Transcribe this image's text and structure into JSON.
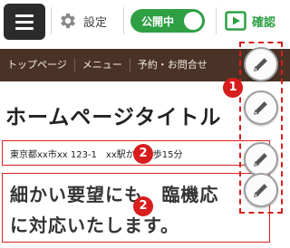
{
  "toolbar": {
    "settings_label": "設定",
    "publish_label": "公開中",
    "preview_label": "確認"
  },
  "nav": {
    "items": [
      {
        "label": "トップページ"
      },
      {
        "label": "メニュー"
      },
      {
        "label": "予約・お問合せ"
      }
    ]
  },
  "page": {
    "title": "ホームページタイトル",
    "address": "東京都xx市xx 123-1　xx駅から徒歩15分",
    "catch_line1": "細かい要望にも、臨機応",
    "catch_line2": "に対応いたします。"
  },
  "badges": {
    "b1": "1",
    "b2": "2",
    "b3": "2"
  },
  "icons": {
    "menu": "hamburger-icon",
    "settings": "gear-icon",
    "preview": "play-square-icon",
    "edit": "pencil-icon"
  },
  "colors": {
    "accent_green": "#2ea043",
    "nav_brown": "#4a3226",
    "highlight_red": "#dd2020"
  }
}
